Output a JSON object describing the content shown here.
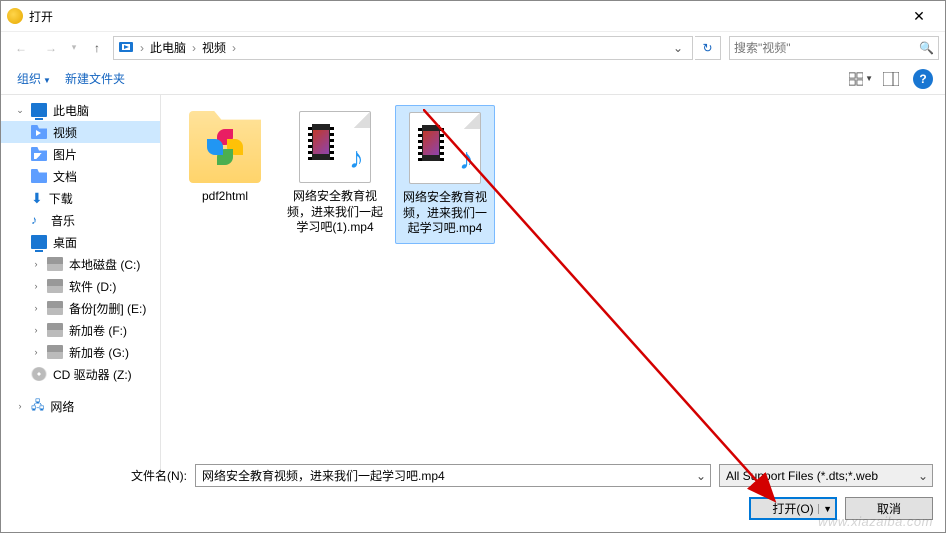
{
  "title": "打开",
  "breadcrumb": {
    "root": "此电脑",
    "folder": "视频"
  },
  "search": {
    "placeholder": "搜索\"视频\""
  },
  "toolbar": {
    "organize": "组织",
    "new_folder": "新建文件夹"
  },
  "sidebar": {
    "this_pc": "此电脑",
    "videos": "视频",
    "pictures": "图片",
    "documents": "文档",
    "downloads": "下载",
    "music": "音乐",
    "desktop": "桌面",
    "local_c": "本地磁盘 (C:)",
    "soft_d": "软件 (D:)",
    "backup_e": "备份[勿删] (E:)",
    "newvol_f": "新加卷 (F:)",
    "newvol_g": "新加卷 (G:)",
    "cd_z": "CD 驱动器 (Z:)",
    "network": "网络"
  },
  "files": {
    "f0": "pdf2html",
    "f1": "网络安全教育视频，进来我们一起学习吧(1).mp4",
    "f2": "网络安全教育视频，进来我们一起学习吧.mp4"
  },
  "footer": {
    "filename_label": "文件名(N):",
    "filename_value": "网络安全教育视频，进来我们一起学习吧.mp4",
    "filetype": "All Support Files (*.dts;*.web",
    "open": "打开(O)",
    "cancel": "取消"
  },
  "watermark": "www.xiazaiba.com"
}
